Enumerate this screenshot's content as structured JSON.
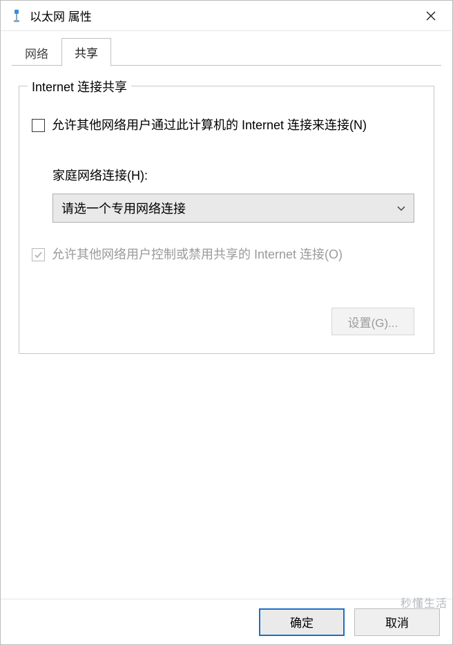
{
  "window": {
    "title": "以太网 属性"
  },
  "tabs": {
    "network": "网络",
    "sharing": "共享",
    "active": "sharing"
  },
  "group": {
    "legend": "Internet 连接共享",
    "allow_connect": {
      "label": "允许其他网络用户通过此计算机的 Internet 连接来连接(N)",
      "checked": false
    },
    "home_network": {
      "label": "家庭网络连接(H):",
      "selected": "请选一个专用网络连接"
    },
    "allow_control": {
      "label": "允许其他网络用户控制或禁用共享的 Internet 连接(O)",
      "checked": true,
      "disabled": true
    },
    "settings_button": "设置(G)..."
  },
  "footer": {
    "ok": "确定",
    "cancel": "取消"
  },
  "watermark": "秒懂生活"
}
